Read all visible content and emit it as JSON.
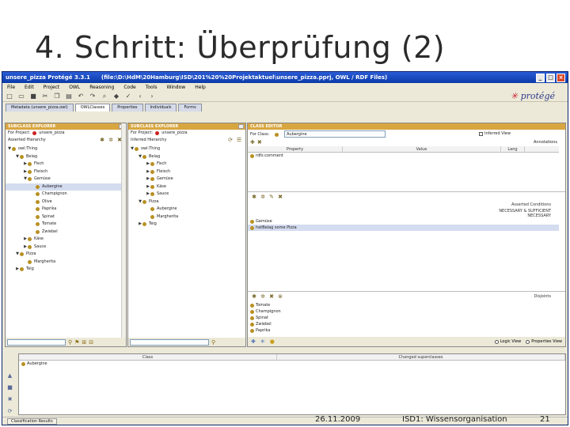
{
  "slide": {
    "title": "4. Schritt: Überprüfung (2)",
    "footer_date": "26.11.2009",
    "footer_course": "ISD1: Wissensorganisation",
    "footer_page": "21"
  },
  "window": {
    "title": "unsere_pizza  Protégé 3.3.1",
    "path": "(file:\\D:\\HdM\\20Hamburg\\ISD\\201%20%20Projektaktuel\\unsere_pizza.pprj, OWL / RDF Files)",
    "min": "_",
    "max": "□",
    "close": "×"
  },
  "menu": [
    "File",
    "Edit",
    "Project",
    "OWL",
    "Reasoning",
    "Code",
    "Tools",
    "Window",
    "Help"
  ],
  "logo": "protégé",
  "tabs": [
    {
      "label": "Metadata (unsere_pizza.owl)",
      "active": false
    },
    {
      "label": "OWLClasses",
      "active": true
    },
    {
      "label": "Properties",
      "active": false
    },
    {
      "label": "Individuals",
      "active": false
    },
    {
      "label": "Forms",
      "active": false
    }
  ],
  "left_panel": {
    "header": "SUBCLASS EXPLORER",
    "project_label": "For Project:",
    "project_name": "unsere_pizza",
    "hierarchy_label": "Asserted Hierarchy",
    "tree": [
      {
        "label": "owl:Thing",
        "indent": 0,
        "arrow": "▼"
      },
      {
        "label": "Belag",
        "indent": 1,
        "arrow": "▼"
      },
      {
        "label": "Fisch",
        "indent": 2,
        "arrow": "▶"
      },
      {
        "label": "Fleisch",
        "indent": 2,
        "arrow": "▶"
      },
      {
        "label": "Gemüse",
        "indent": 2,
        "arrow": "▼"
      },
      {
        "label": "Aubergine",
        "indent": 3,
        "arrow": "",
        "selected": true
      },
      {
        "label": "Champignon",
        "indent": 3,
        "arrow": ""
      },
      {
        "label": "Olive",
        "indent": 3,
        "arrow": ""
      },
      {
        "label": "Paprika",
        "indent": 3,
        "arrow": ""
      },
      {
        "label": "Spinat",
        "indent": 3,
        "arrow": ""
      },
      {
        "label": "Tomate",
        "indent": 3,
        "arrow": ""
      },
      {
        "label": "Zwiebel",
        "indent": 3,
        "arrow": ""
      },
      {
        "label": "Käse",
        "indent": 2,
        "arrow": "▶"
      },
      {
        "label": "Sauce",
        "indent": 2,
        "arrow": "▶"
      },
      {
        "label": "Pizza",
        "indent": 1,
        "arrow": "▼"
      },
      {
        "label": "Margherita",
        "indent": 2,
        "arrow": ""
      },
      {
        "label": "Teig",
        "indent": 1,
        "arrow": "▶"
      }
    ]
  },
  "middle_panel": {
    "header": "SUBCLASS EXPLORER",
    "project_label": "For Project:",
    "project_name": "unsere_pizza",
    "hierarchy_label": "Inferred Hierarchy",
    "tree": [
      {
        "label": "owl:Thing",
        "indent": 0,
        "arrow": "▼"
      },
      {
        "label": "Belag",
        "indent": 1,
        "arrow": "▼"
      },
      {
        "label": "Fisch",
        "indent": 2,
        "arrow": "▶"
      },
      {
        "label": "Fleisch",
        "indent": 2,
        "arrow": "▶"
      },
      {
        "label": "Gemüse",
        "indent": 2,
        "arrow": "▶"
      },
      {
        "label": "Käse",
        "indent": 2,
        "arrow": "▶"
      },
      {
        "label": "Sauce",
        "indent": 2,
        "arrow": "▶"
      },
      {
        "label": "Pizza",
        "indent": 1,
        "arrow": "▼"
      },
      {
        "label": "Aubergine",
        "indent": 2,
        "arrow": ""
      },
      {
        "label": "Margherita",
        "indent": 2,
        "arrow": ""
      },
      {
        "label": "Teig",
        "indent": 1,
        "arrow": "▶"
      }
    ]
  },
  "class_editor": {
    "header": "CLASS EDITOR",
    "for_class_label": "For Class:",
    "for_class_value": "Aubergine",
    "inferred_label": "Inferred View",
    "annotations_label": "Annotations",
    "col_property": "Property",
    "col_value": "Value",
    "col_lang": "Lang",
    "annotation_row": "rdfs:comment",
    "asserted_conditions_label": "Asserted Conditions",
    "necessary_sufficient": "NECESSARY & SUFFICIENT",
    "necessary": "NECESSARY",
    "conditions": [
      {
        "label": "Gemüse",
        "highlight": false
      },
      {
        "label": "hatBelag some Pizza",
        "highlight": true
      }
    ],
    "disjoints_label": "Disjoints",
    "disjoints": [
      "Tomate",
      "Champignon",
      "Spinat",
      "Zwiebel",
      "Paprika"
    ],
    "logic_view": "Logic View",
    "properties_view": "Properties View"
  },
  "bottom": {
    "col_class": "Class",
    "col_changed": "Changed superclasses",
    "row_label": "Aubergine",
    "task": "Classification Results"
  }
}
